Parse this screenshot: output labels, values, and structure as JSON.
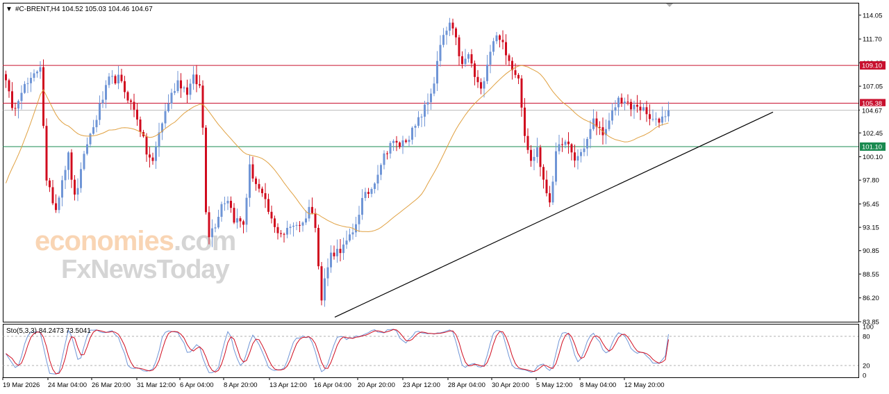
{
  "header": {
    "symbol": "#C-BRENT,H4",
    "ohlc": "104.52 105.03 104.46 104.67"
  },
  "watermark": {
    "line1_orange": "economies",
    "line1_gray": ".com",
    "line2": "FxNewsToday"
  },
  "stochastic_label": "Sto(5,3,3) 84.2473 73.5041",
  "price_axis_ticks": [
    "114.05",
    "111.70",
    "109.35",
    "107.05",
    "104.70",
    "102.45",
    "100.10",
    "97.80",
    "95.45",
    "93.15",
    "90.85",
    "88.55",
    "86.20",
    "83.85"
  ],
  "osc_axis_ticks": [
    "100",
    "80",
    "20",
    "0"
  ],
  "time_axis_ticks": [
    "19 Mar 2026",
    "24 Mar 04:00",
    "26 Mar 20:00",
    "31 Mar 12:00",
    "6 Apr 04:00",
    "8 Apr 20:00",
    "13 Apr 12:00",
    "16 Apr 04:00",
    "20 Apr 20:00",
    "23 Apr 12:00",
    "28 Apr 04:00",
    "30 Apr 20:00",
    "5 May 12:00",
    "8 May 04:00",
    "12 May 20:00"
  ],
  "level_tags": {
    "resistance": "109.10",
    "resistance2": "105.38",
    "current": "104.67",
    "support": "101.10"
  },
  "colors": {
    "bull": "#6f95d6",
    "bear": "#d00b1e",
    "ma": "#e0a040",
    "resistance_line": "#c8102e",
    "support_line": "#1a8a50",
    "trendline": "#000000",
    "stoch_main": "#6f95d6",
    "stoch_signal": "#d00b1e"
  },
  "chart_data": {
    "type": "candlestick",
    "instrument": "#C-BRENT",
    "timeframe": "H4",
    "last_ohlc": {
      "open": 104.52,
      "high": 105.03,
      "low": 104.46,
      "close": 104.67
    },
    "ylim": [
      83.85,
      115.2
    ],
    "horizontal_levels": {
      "resistance": 109.1,
      "resistance2": 105.38,
      "current": 104.67,
      "support": 101.1
    },
    "trendline": {
      "from": {
        "bar": 0,
        "price": 84.3
      },
      "to": {
        "bar": 138,
        "price": 104.5
      }
    },
    "moving_average": "orange line",
    "oscillator": {
      "name": "Sto(5,3,3)",
      "main": 84.2473,
      "signal": 73.5041,
      "levels": [
        20,
        80
      ],
      "ylim": [
        0,
        100
      ]
    },
    "price_path_keypoints": [
      [
        0,
        108.0
      ],
      [
        2,
        104.5
      ],
      [
        5,
        106.8
      ],
      [
        8,
        107.5
      ],
      [
        11,
        109.2
      ],
      [
        13,
        97.5
      ],
      [
        16,
        95.0
      ],
      [
        18,
        98.0
      ],
      [
        20,
        100.2
      ],
      [
        22,
        96.0
      ],
      [
        24,
        98.5
      ],
      [
        26,
        101.5
      ],
      [
        28,
        103.0
      ],
      [
        30,
        105.0
      ],
      [
        33,
        107.6
      ],
      [
        36,
        107.8
      ],
      [
        39,
        106.0
      ],
      [
        42,
        104.0
      ],
      [
        45,
        100.5
      ],
      [
        47,
        99.5
      ],
      [
        49,
        102.5
      ],
      [
        52,
        105.5
      ],
      [
        55,
        107.6
      ],
      [
        58,
        106.5
      ],
      [
        60,
        107.8
      ],
      [
        62,
        107.0
      ],
      [
        63,
        103.0
      ],
      [
        64,
        95.0
      ],
      [
        65,
        92.5
      ],
      [
        67,
        93.5
      ],
      [
        69,
        95.5
      ],
      [
        71,
        96.0
      ],
      [
        73,
        94.0
      ],
      [
        76,
        93.5
      ],
      [
        78,
        99.0
      ],
      [
        80,
        97.5
      ],
      [
        83,
        95.5
      ],
      [
        86,
        93.0
      ],
      [
        89,
        92.5
      ],
      [
        92,
        93.5
      ],
      [
        95,
        93.5
      ],
      [
        97,
        95.2
      ],
      [
        99,
        93.5
      ],
      [
        101,
        86.0
      ],
      [
        102,
        88.0
      ],
      [
        104,
        90.5
      ],
      [
        108,
        91.2
      ],
      [
        111,
        92.5
      ],
      [
        114,
        95.8
      ],
      [
        117,
        97.0
      ],
      [
        120,
        99.5
      ],
      [
        123,
        101.5
      ],
      [
        126,
        101.2
      ],
      [
        129,
        102.2
      ],
      [
        131,
        103.0
      ],
      [
        133,
        104.3
      ],
      [
        135,
        105.5
      ],
      [
        137,
        107.5
      ],
      [
        139,
        111.0
      ],
      [
        141,
        112.5
      ],
      [
        142,
        113.2
      ],
      [
        144,
        111.5
      ],
      [
        146,
        109.0
      ],
      [
        148,
        110.2
      ],
      [
        150,
        108.0
      ],
      [
        152,
        106.5
      ],
      [
        154,
        109.5
      ],
      [
        156,
        111.7
      ],
      [
        158,
        112.0
      ],
      [
        160,
        110.0
      ],
      [
        162,
        109.0
      ],
      [
        164,
        108.0
      ],
      [
        166,
        102.5
      ],
      [
        168,
        99.5
      ],
      [
        170,
        101.0
      ],
      [
        172,
        97.5
      ],
      [
        174,
        95.8
      ],
      [
        176,
        100.2
      ],
      [
        178,
        101.7
      ],
      [
        180,
        101.0
      ],
      [
        182,
        99.8
      ],
      [
        184,
        100.5
      ],
      [
        186,
        101.8
      ],
      [
        188,
        103.6
      ],
      [
        190,
        102.8
      ],
      [
        192,
        102.5
      ],
      [
        194,
        104.3
      ],
      [
        196,
        105.8
      ],
      [
        198,
        105.5
      ],
      [
        200,
        104.8
      ],
      [
        202,
        105.2
      ],
      [
        204,
        104.6
      ],
      [
        206,
        103.8
      ],
      [
        208,
        103.5
      ],
      [
        210,
        104.0
      ],
      [
        212,
        104.7
      ]
    ]
  }
}
